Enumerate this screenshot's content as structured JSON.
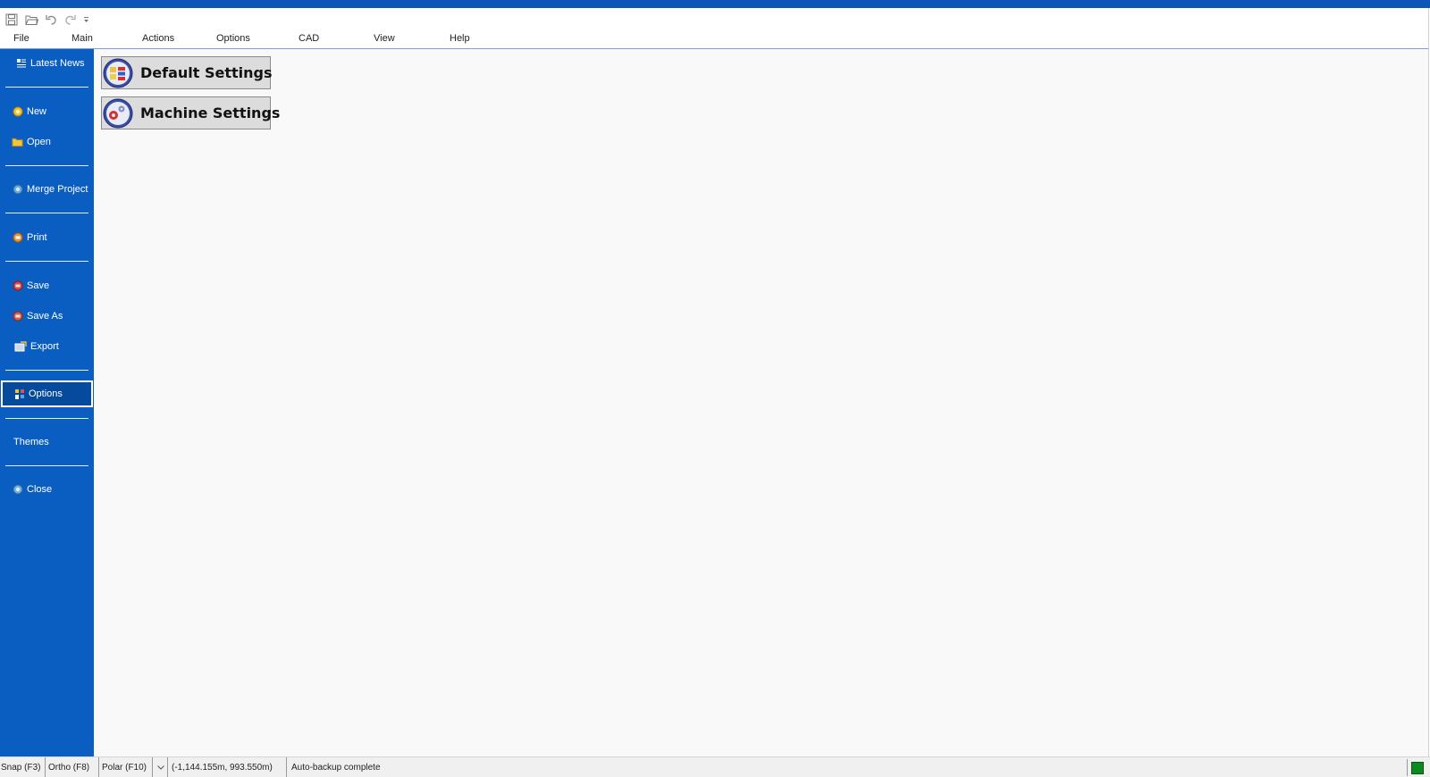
{
  "menubar": {
    "items": [
      "File",
      "Main",
      "Actions",
      "Options",
      "CAD",
      "View",
      "Help"
    ]
  },
  "quick_access": {
    "icons": [
      "save-icon",
      "open-folder-icon",
      "undo-icon",
      "redo-icon",
      "customize-dropdown-icon"
    ]
  },
  "sidebar": {
    "latest_news": "Latest News",
    "new": "New",
    "open": "Open",
    "merge_project": "Merge Project",
    "print": "Print",
    "save": "Save",
    "save_as": "Save As",
    "export": "Export",
    "options": "Options",
    "themes": "Themes",
    "close": "Close",
    "active_item": "Options"
  },
  "main": {
    "buttons": [
      {
        "label": "Default Settings",
        "icon": "default-settings-icon"
      },
      {
        "label": "Machine Settings",
        "icon": "machine-settings-icon"
      }
    ]
  },
  "statusbar": {
    "snap": "Snap (F3)",
    "ortho": "Ortho (F8)",
    "polar": "Polar (F10)",
    "coordinates": "(-1,144.155m, 993.550m)",
    "message": "Auto-backup complete",
    "indicator_color": "#0b8a1f"
  },
  "colors": {
    "accent": "#0b5ec1",
    "title_strip": "#0d56b9",
    "active_item": "#064a9e"
  }
}
